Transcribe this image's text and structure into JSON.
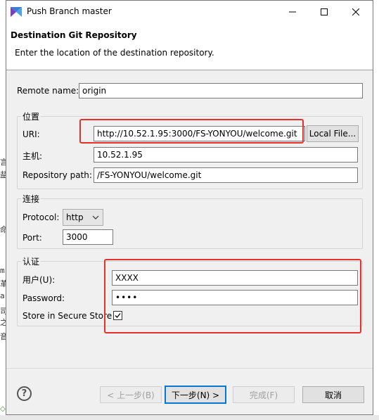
{
  "window": {
    "title": "Push Branch master"
  },
  "banner": {
    "title": "Destination Git Repository",
    "description": "Enter the location of the destination repository."
  },
  "remote": {
    "label": "Remote name:",
    "value": "origin"
  },
  "location_group": {
    "title": "位置",
    "uri_label": "URI:",
    "uri_value": "http://10.52.1.95:3000/FS-YONYOU/welcome.git",
    "local_file_button": "Local File...",
    "host_label": "主机:",
    "host_value": "10.52.1.95",
    "repo_path_label": "Repository path:",
    "repo_path_value": "/FS-YONYOU/welcome.git"
  },
  "connection_group": {
    "title": "连接",
    "protocol_label": "Protocol:",
    "protocol_value": "http",
    "port_label": "Port:",
    "port_value": "3000"
  },
  "auth_group": {
    "title": "认证",
    "user_label": "用户(U):",
    "user_value": "XXXX",
    "password_label": "Password:",
    "password_value": "••••",
    "secure_store_label": "Store in Secure Store",
    "secure_store_checked": true
  },
  "footer": {
    "back_button": "< 上一步(B)",
    "next_button": "下一步(N) >",
    "finish_button": "完成(F)",
    "cancel_button": "取消"
  },
  "colors": {
    "highlight": "#e8302a",
    "focus": "#0078d7"
  },
  "icons": {
    "app": "eclipse-logo-icon",
    "help": "help-icon",
    "minimize": "minimize-icon",
    "maximize": "maximize-icon",
    "close": "close-icon",
    "dropdown": "chevron-down-icon",
    "check": "checkmark-icon"
  }
}
